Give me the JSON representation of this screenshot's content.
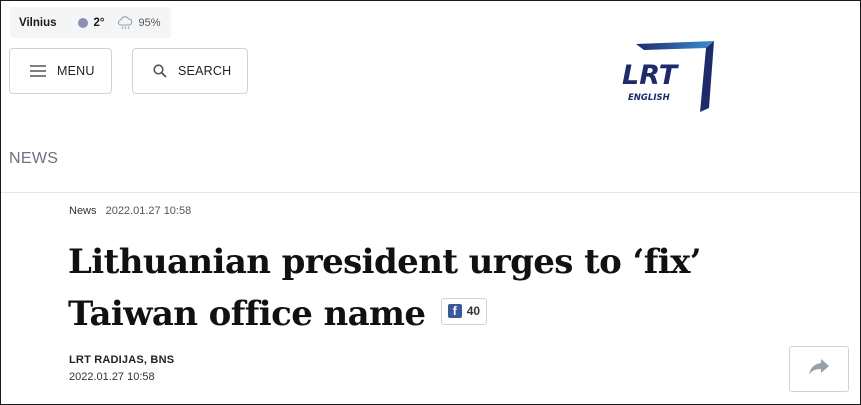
{
  "weather": {
    "city": "Vilnius",
    "temperature": "2°",
    "humidity": "95%"
  },
  "header": {
    "menu_label": "MENU",
    "search_label": "SEARCH",
    "logo_text": "LRT",
    "logo_sub": "ENGLISH"
  },
  "section": {
    "title": "NEWS"
  },
  "article": {
    "category": "News",
    "datetime_top": "2022.01.27 10:58",
    "title": "Lithuanian president urges to ‘fix’ Taiwan office name",
    "fb_count": "40",
    "author": "LRT RADIJAS, BNS",
    "datetime_bottom": "2022.01.27 10:58"
  },
  "colors": {
    "brand_blue": "#1f2a6b",
    "accent_blue": "#3b8fd6",
    "facebook": "#3b5998",
    "muted": "#6b7280"
  },
  "icons": [
    "cloud-rain-icon",
    "hamburger-icon",
    "search-icon",
    "facebook-icon",
    "share-arrow-icon"
  ]
}
